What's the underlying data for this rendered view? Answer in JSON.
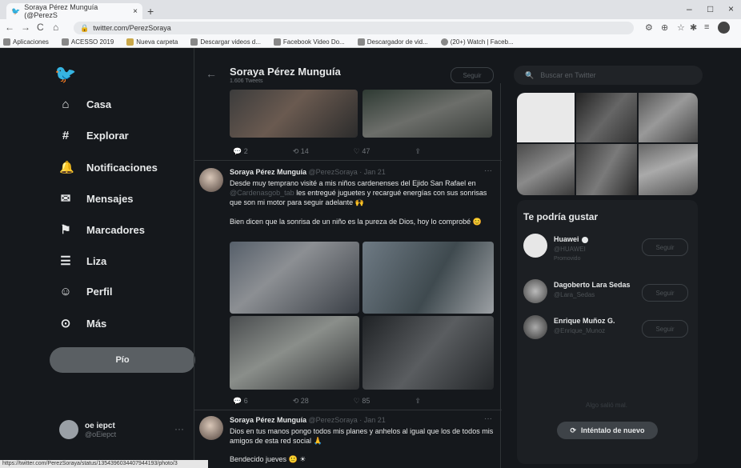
{
  "browser": {
    "tab_title": "Soraya Pérez Munguía (@PerezS",
    "tab_close": "×",
    "new_tab": "+",
    "minimize": "–",
    "maximize": "□",
    "close": "×",
    "back": "←",
    "forward": "→",
    "reload": "C",
    "home": "⌂",
    "url": "twitter.com/PerezSoraya",
    "bookmarks": [
      "Aplicaciones",
      "ACESSO 2019",
      "Nueva carpeta",
      "Descargar videos d...",
      "Facebook Video Do...",
      "Descargador de vid...",
      "(20+) Watch | Faceb..."
    ],
    "status_url": "https://twitter.com/PerezSoraya/status/1354396034407944193/photo/3"
  },
  "sidebar": {
    "items": [
      {
        "label": "Casa",
        "icon": "home-icon",
        "glyph": "⌂"
      },
      {
        "label": "Explorar",
        "icon": "hashtag-icon",
        "glyph": "#"
      },
      {
        "label": "Notificaciones",
        "icon": "bell-icon",
        "glyph": "🔔"
      },
      {
        "label": "Mensajes",
        "icon": "envelope-icon",
        "glyph": "✉"
      },
      {
        "label": "Marcadores",
        "icon": "bookmark-icon",
        "glyph": "⚑"
      },
      {
        "label": "Liza",
        "icon": "list-icon",
        "glyph": "☰"
      },
      {
        "label": "Perfil",
        "icon": "person-icon",
        "glyph": "☺"
      },
      {
        "label": "Más",
        "icon": "more-circle-icon",
        "glyph": "⊙"
      }
    ],
    "post_button": "Pío",
    "account_name": "oe iepct",
    "account_handle": "@oEiepct",
    "account_more": "···"
  },
  "profile": {
    "name": "Soraya Pérez Munguía",
    "tweet_count": "1.606 Tweets",
    "follow": "Seguir",
    "back_glyph": "←"
  },
  "tweets": [
    {
      "actions": {
        "reply": "2",
        "retweet": "14",
        "like": "47"
      }
    },
    {
      "name": "Soraya Pérez Munguía",
      "handle": "@PerezSoraya · Jan 21",
      "text1": "Desde muy temprano visité a mis niños cardenenses del Ejido San Rafael en",
      "mention": "@Cardenasgob_tab",
      "text2": " les entregué juguetes y recargué energías con sus sonrisas que son mi motor para seguir adelante 🙌",
      "text3": "Bien dicen que la sonrisa de un niño es la pureza de Dios, hoy lo comprobé 😊",
      "more": "···",
      "actions": {
        "reply": "6",
        "retweet": "28",
        "like": "85"
      }
    },
    {
      "name": "Soraya Pérez Munguía",
      "handle": "@PerezSoraya · Jan 21",
      "text1": "Dios en tus manos pongo todos mis planes y anhelos al igual que los de todos mis amigos de esta red social 🙏",
      "text3": "Bendecido jueves 🙂 ☀",
      "more": "···"
    }
  ],
  "right": {
    "search_placeholder": "Buscar en Twitter",
    "suggest_title": "Te podría gustar",
    "suggestions": [
      {
        "name": "Huawei",
        "handle": "@HUAWEI",
        "promo": "Promovido",
        "follow": "Seguir"
      },
      {
        "name": "Dagoberto Lara Sedas",
        "handle": "@Lara_Sedas",
        "follow": "Seguir"
      },
      {
        "name": "Enrique Muñoz G.",
        "handle": "@Enrique_Munoz",
        "follow": "Seguir"
      }
    ],
    "error_text": "Algo salió mal.",
    "retry": "Inténtalo de nuevo"
  }
}
